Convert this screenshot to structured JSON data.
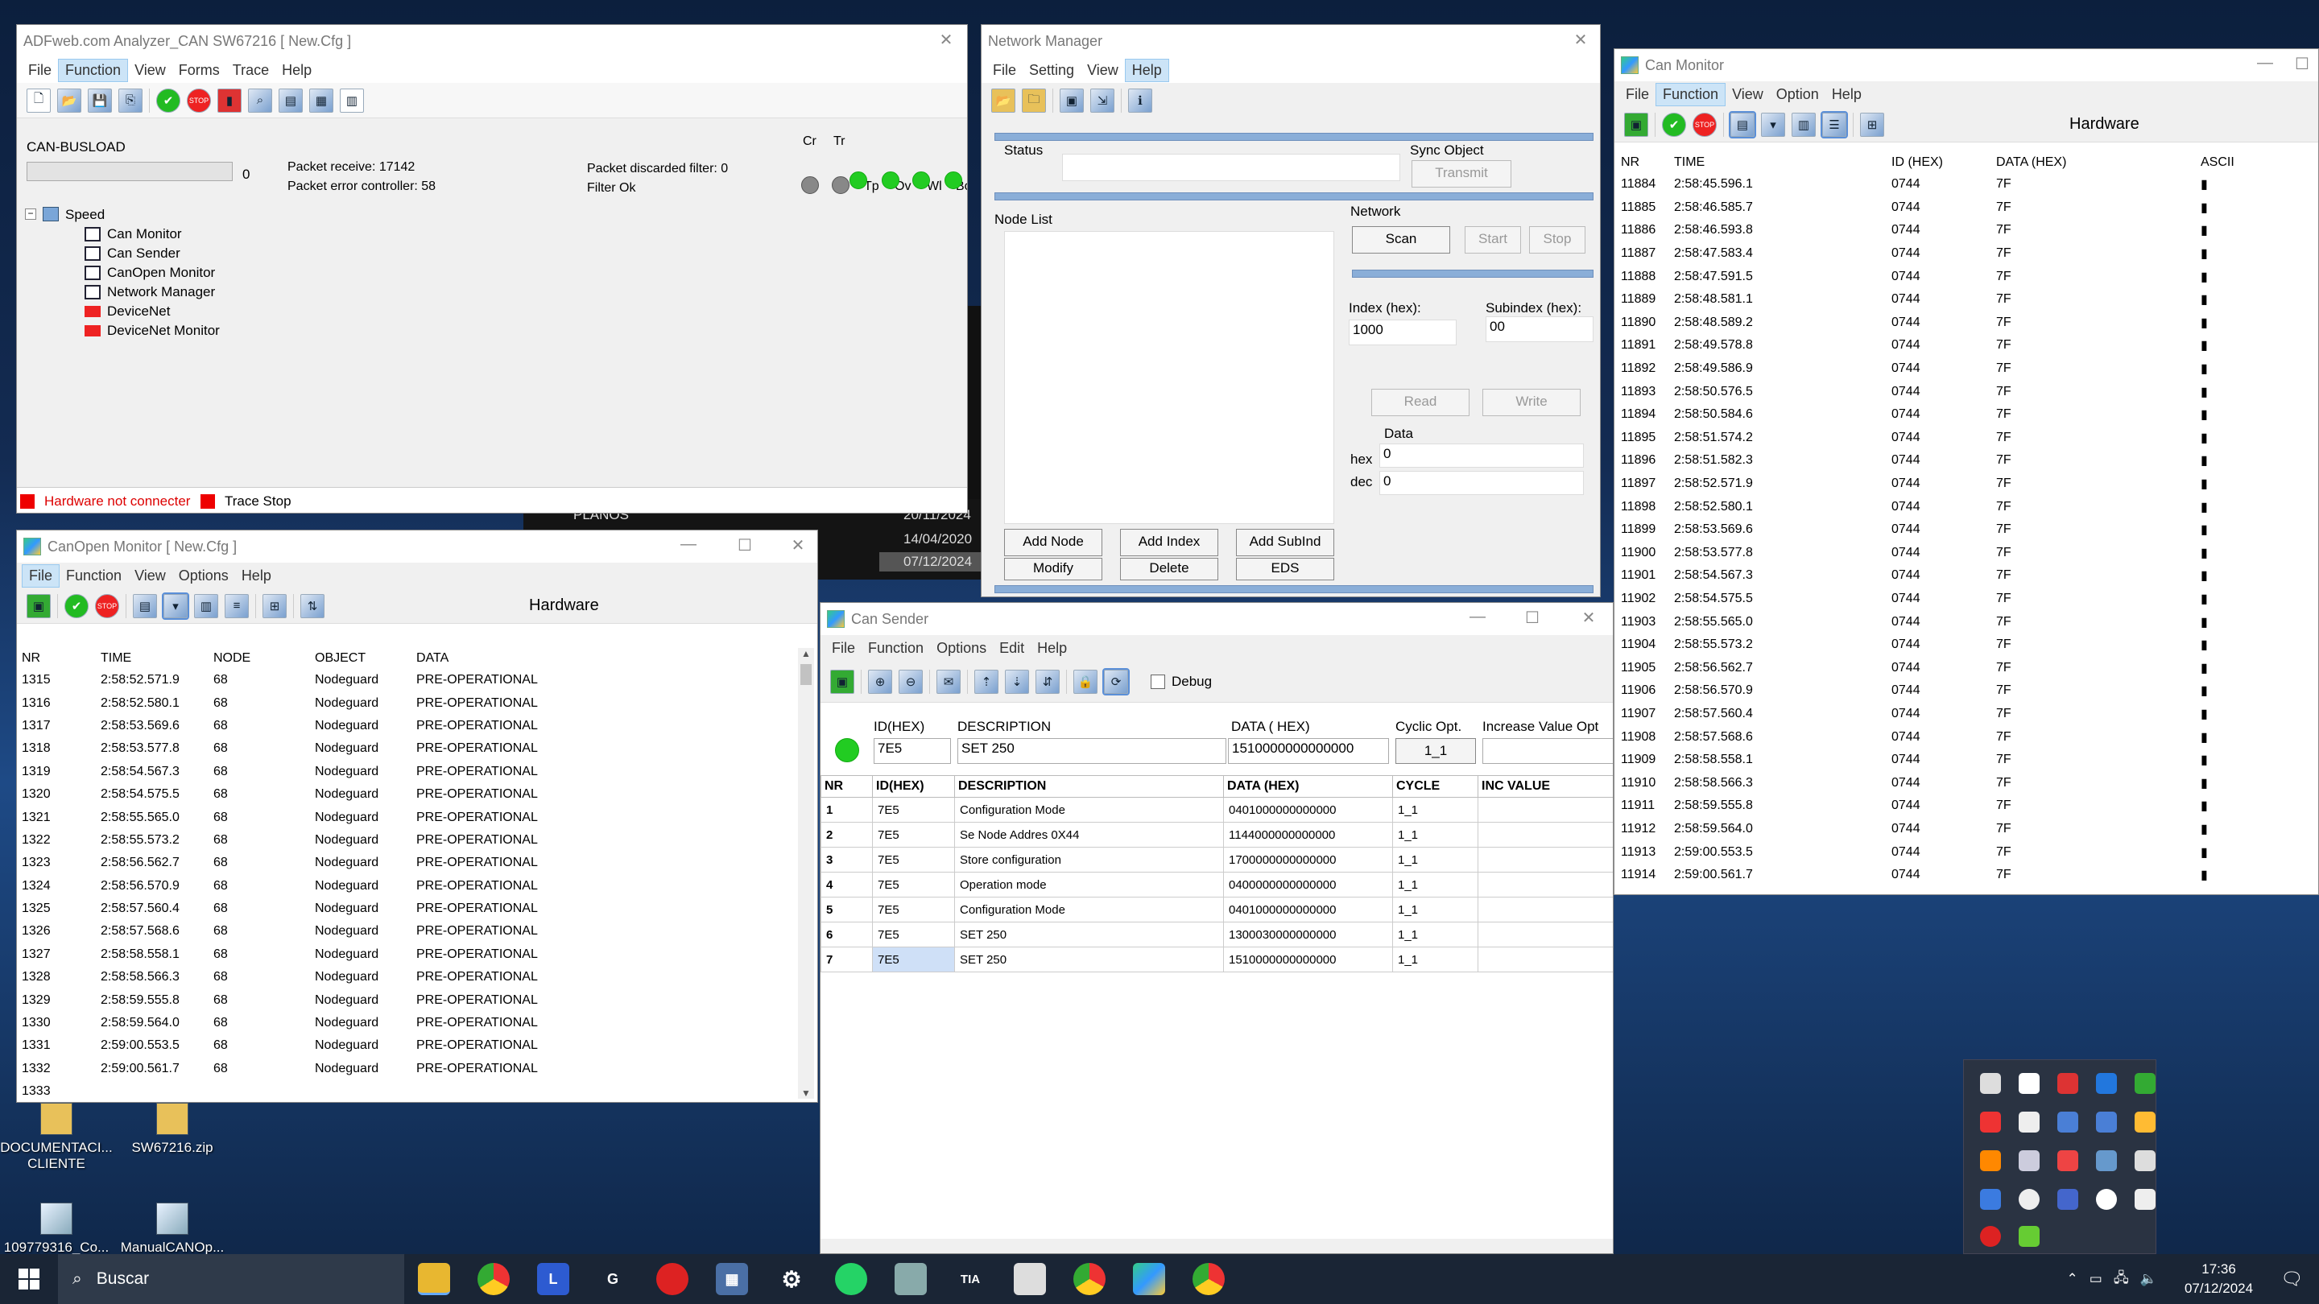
{
  "adf": {
    "title": "ADFweb.com Analyzer_CAN SW67216 [ New.Cfg ]",
    "menu": [
      "File",
      "Function",
      "View",
      "Forms",
      "Trace",
      "Help"
    ],
    "busload_label": "CAN-BUSLOAD",
    "busload_value": "0",
    "packet_receive": "Packet receive: 17142",
    "packet_error": "Packet error controller: 58",
    "packet_discarded": "Packet discarded filter: 0",
    "filter_status": "Filter Ok",
    "leds": [
      "Cr",
      "Tr",
      "Tp",
      "Ov",
      "Wl",
      "Bo"
    ],
    "tree_root": "Speed",
    "tree_items": [
      "Can Monitor",
      "Can Sender",
      "CanOpen Monitor",
      "Network Manager",
      "DeviceNet",
      "DeviceNet Monitor"
    ],
    "status_hw": "Hardware not connecter",
    "status_trace": "Trace Stop"
  },
  "network_manager": {
    "title": "Network Manager",
    "menu": [
      "File",
      "Setting",
      "View",
      "Help"
    ],
    "status_label": "Status",
    "sync_label": "Sync Object",
    "transmit": "Transmit",
    "node_list": "Node List",
    "network_label": "Network",
    "scan": "Scan",
    "start": "Start",
    "stop": "Stop",
    "index_label": "Index (hex):",
    "index_value": "1000",
    "subindex_label": "Subindex (hex):",
    "subindex_value": "00",
    "read": "Read",
    "write": "Write",
    "data_label": "Data",
    "hex_label": "hex",
    "hex_value": "0",
    "dec_label": "dec",
    "dec_value": "0",
    "add_node": "Add Node",
    "add_index": "Add Index",
    "add_subind": "Add SubInd",
    "modify": "Modify",
    "delete": "Delete",
    "eds": "EDS"
  },
  "can_monitor": {
    "title": "Can Monitor",
    "menu": [
      "File",
      "Function",
      "View",
      "Option",
      "Help"
    ],
    "hardware": "Hardware",
    "headers": [
      "NR",
      "TIME",
      "ID (HEX)",
      "DATA (HEX)",
      "ASCII"
    ],
    "rows": [
      [
        "11884",
        "2:58:45.596.1",
        "0744",
        "7F",
        "▮"
      ],
      [
        "11885",
        "2:58:46.585.7",
        "0744",
        "7F",
        "▮"
      ],
      [
        "11886",
        "2:58:46.593.8",
        "0744",
        "7F",
        "▮"
      ],
      [
        "11887",
        "2:58:47.583.4",
        "0744",
        "7F",
        "▮"
      ],
      [
        "11888",
        "2:58:47.591.5",
        "0744",
        "7F",
        "▮"
      ],
      [
        "11889",
        "2:58:48.581.1",
        "0744",
        "7F",
        "▮"
      ],
      [
        "11890",
        "2:58:48.589.2",
        "0744",
        "7F",
        "▮"
      ],
      [
        "11891",
        "2:58:49.578.8",
        "0744",
        "7F",
        "▮"
      ],
      [
        "11892",
        "2:58:49.586.9",
        "0744",
        "7F",
        "▮"
      ],
      [
        "11893",
        "2:58:50.576.5",
        "0744",
        "7F",
        "▮"
      ],
      [
        "11894",
        "2:58:50.584.6",
        "0744",
        "7F",
        "▮"
      ],
      [
        "11895",
        "2:58:51.574.2",
        "0744",
        "7F",
        "▮"
      ],
      [
        "11896",
        "2:58:51.582.3",
        "0744",
        "7F",
        "▮"
      ],
      [
        "11897",
        "2:58:52.571.9",
        "0744",
        "7F",
        "▮"
      ],
      [
        "11898",
        "2:58:52.580.1",
        "0744",
        "7F",
        "▮"
      ],
      [
        "11899",
        "2:58:53.569.6",
        "0744",
        "7F",
        "▮"
      ],
      [
        "11900",
        "2:58:53.577.8",
        "0744",
        "7F",
        "▮"
      ],
      [
        "11901",
        "2:58:54.567.3",
        "0744",
        "7F",
        "▮"
      ],
      [
        "11902",
        "2:58:54.575.5",
        "0744",
        "7F",
        "▮"
      ],
      [
        "11903",
        "2:58:55.565.0",
        "0744",
        "7F",
        "▮"
      ],
      [
        "11904",
        "2:58:55.573.2",
        "0744",
        "7F",
        "▮"
      ],
      [
        "11905",
        "2:58:56.562.7",
        "0744",
        "7F",
        "▮"
      ],
      [
        "11906",
        "2:58:56.570.9",
        "0744",
        "7F",
        "▮"
      ],
      [
        "11907",
        "2:58:57.560.4",
        "0744",
        "7F",
        "▮"
      ],
      [
        "11908",
        "2:58:57.568.6",
        "0744",
        "7F",
        "▮"
      ],
      [
        "11909",
        "2:58:58.558.1",
        "0744",
        "7F",
        "▮"
      ],
      [
        "11910",
        "2:58:58.566.3",
        "0744",
        "7F",
        "▮"
      ],
      [
        "11911",
        "2:58:59.555.8",
        "0744",
        "7F",
        "▮"
      ],
      [
        "11912",
        "2:58:59.564.0",
        "0744",
        "7F",
        "▮"
      ],
      [
        "11913",
        "2:59:00.553.5",
        "0744",
        "7F",
        "▮"
      ],
      [
        "11914",
        "2:59:00.561.7",
        "0744",
        "7F",
        "▮"
      ]
    ]
  },
  "canopen": {
    "title": "CanOpen Monitor [ New.Cfg ]",
    "menu": [
      "File",
      "Function",
      "View",
      "Options",
      "Help"
    ],
    "hardware": "Hardware",
    "headers": [
      "NR",
      "TIME",
      "NODE",
      "OBJECT",
      "DATA"
    ],
    "rows": [
      [
        "1315",
        "2:58:52.571.9",
        "68",
        "Nodeguard",
        "PRE-OPERATIONAL"
      ],
      [
        "1316",
        "2:58:52.580.1",
        "68",
        "Nodeguard",
        "PRE-OPERATIONAL"
      ],
      [
        "1317",
        "2:58:53.569.6",
        "68",
        "Nodeguard",
        "PRE-OPERATIONAL"
      ],
      [
        "1318",
        "2:58:53.577.8",
        "68",
        "Nodeguard",
        "PRE-OPERATIONAL"
      ],
      [
        "1319",
        "2:58:54.567.3",
        "68",
        "Nodeguard",
        "PRE-OPERATIONAL"
      ],
      [
        "1320",
        "2:58:54.575.5",
        "68",
        "Nodeguard",
        "PRE-OPERATIONAL"
      ],
      [
        "1321",
        "2:58:55.565.0",
        "68",
        "Nodeguard",
        "PRE-OPERATIONAL"
      ],
      [
        "1322",
        "2:58:55.573.2",
        "68",
        "Nodeguard",
        "PRE-OPERATIONAL"
      ],
      [
        "1323",
        "2:58:56.562.7",
        "68",
        "Nodeguard",
        "PRE-OPERATIONAL"
      ],
      [
        "1324",
        "2:58:56.570.9",
        "68",
        "Nodeguard",
        "PRE-OPERATIONAL"
      ],
      [
        "1325",
        "2:58:57.560.4",
        "68",
        "Nodeguard",
        "PRE-OPERATIONAL"
      ],
      [
        "1326",
        "2:58:57.568.6",
        "68",
        "Nodeguard",
        "PRE-OPERATIONAL"
      ],
      [
        "1327",
        "2:58:58.558.1",
        "68",
        "Nodeguard",
        "PRE-OPERATIONAL"
      ],
      [
        "1328",
        "2:58:58.566.3",
        "68",
        "Nodeguard",
        "PRE-OPERATIONAL"
      ],
      [
        "1329",
        "2:58:59.555.8",
        "68",
        "Nodeguard",
        "PRE-OPERATIONAL"
      ],
      [
        "1330",
        "2:58:59.564.0",
        "68",
        "Nodeguard",
        "PRE-OPERATIONAL"
      ],
      [
        "1331",
        "2:59:00.553.5",
        "68",
        "Nodeguard",
        "PRE-OPERATIONAL"
      ],
      [
        "1332",
        "2:59:00.561.7",
        "68",
        "Nodeguard",
        "PRE-OPERATIONAL"
      ],
      [
        "1333",
        "",
        "",
        "",
        ""
      ]
    ]
  },
  "can_sender": {
    "title": "Can Sender",
    "menu": [
      "File",
      "Function",
      "Options",
      "Edit",
      "Help"
    ],
    "debug_label": "Debug",
    "form_headers": [
      "ID(HEX)",
      "DESCRIPTION",
      "DATA ( HEX)",
      "Cyclic Opt.",
      "Increase Value Opt"
    ],
    "form_values": {
      "id": "7E5",
      "description": "SET 250",
      "data": "1510000000000000",
      "cycle": "1_1"
    },
    "headers": [
      "NR",
      "ID(HEX)",
      "DESCRIPTION",
      "DATA (HEX)",
      "CYCLE",
      "INC VALUE"
    ],
    "rows": [
      [
        "1",
        "7E5",
        "Configuration Mode",
        "0401000000000000",
        "1_1",
        ""
      ],
      [
        "2",
        "7E5",
        "Se Node Addres 0X44",
        "1144000000000000",
        "1_1",
        ""
      ],
      [
        "3",
        "7E5",
        "Store configuration",
        "1700000000000000",
        "1_1",
        ""
      ],
      [
        "4",
        "7E5",
        "Operation mode",
        "0400000000000000",
        "1_1",
        ""
      ],
      [
        "5",
        "7E5",
        "Configuration Mode",
        "0401000000000000",
        "1_1",
        ""
      ],
      [
        "6",
        "7E5",
        "SET 250",
        "1300030000000000",
        "1_1",
        ""
      ],
      [
        "7",
        "7E5",
        "SET 250",
        "1510000000000000",
        "1_1",
        ""
      ]
    ]
  },
  "desktop": {
    "bg_texts": [
      "PLANOS",
      "20/11/2024",
      "14/04/2020",
      "07/12/2024"
    ],
    "icons": [
      "DOCUMENTACI... CLIENTE",
      "SW67216.zip",
      "109779316_Co...",
      "ManualCANOp..."
    ]
  },
  "taskbar": {
    "search": "Buscar",
    "time": "17:36",
    "date": "07/12/2024"
  }
}
